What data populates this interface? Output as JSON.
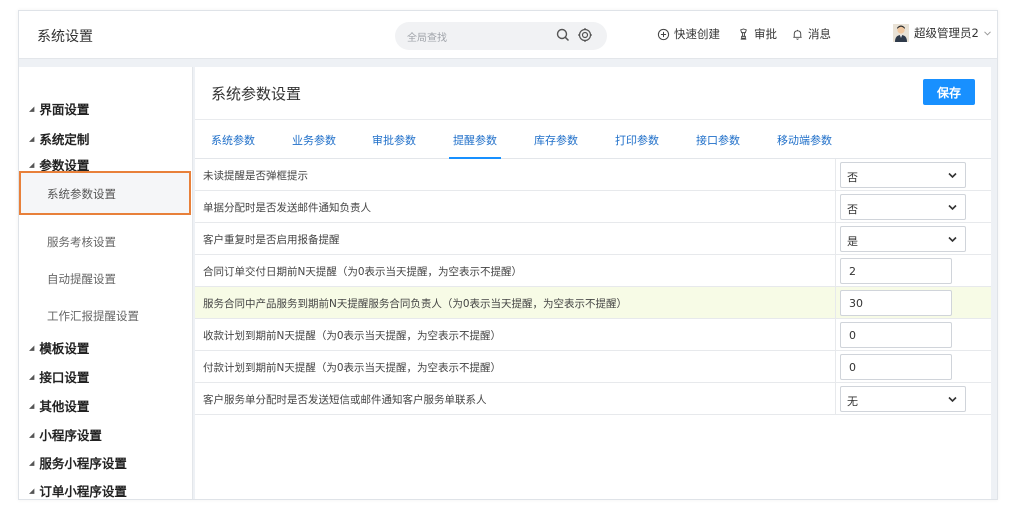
{
  "header": {
    "app_title": "系统设置",
    "search_placeholder": "全局查找",
    "quick_create": "快速创建",
    "approve": "审批",
    "messages": "消息",
    "user_name": "超级管理员2"
  },
  "sidebar": {
    "groups": {
      "ui": "界面设置",
      "custom": "系统定制",
      "params": "参数设置",
      "template": "模板设置",
      "api": "接口设置",
      "other": "其他设置",
      "miniapp": "小程序设置",
      "service_miniapp": "服务小程序设置",
      "order_miniapp": "订单小程序设置"
    },
    "params_items": {
      "system": "系统参数设置",
      "service_eval": "服务考核设置",
      "auto_remind": "自动提醒设置",
      "work_report": "工作汇报提醒设置"
    }
  },
  "main": {
    "title": "系统参数设置",
    "save_label": "保存",
    "tabs": [
      "系统参数",
      "业务参数",
      "审批参数",
      "提醒参数",
      "库存参数",
      "打印参数",
      "接口参数",
      "移动端参数"
    ],
    "active_tab": "提醒参数",
    "rows": [
      {
        "label": "未读提醒是否弹框提示",
        "type": "select",
        "value": "否"
      },
      {
        "label": "单据分配时是否发送邮件通知负责人",
        "type": "select",
        "value": "否"
      },
      {
        "label": "客户重复时是否启用报备提醒",
        "type": "select",
        "value": "是"
      },
      {
        "label": "合同订单交付日期前N天提醒（为0表示当天提醒，为空表示不提醒）",
        "type": "input",
        "value": "2"
      },
      {
        "label": "服务合同中产品服务到期前N天提醒服务合同负责人（为0表示当天提醒，为空表示不提醒）",
        "type": "input",
        "value": "30"
      },
      {
        "label": "收款计划到期前N天提醒（为0表示当天提醒，为空表示不提醒）",
        "type": "input",
        "value": "0"
      },
      {
        "label": "付款计划到期前N天提醒（为0表示当天提醒，为空表示不提醒）",
        "type": "input",
        "value": "0"
      },
      {
        "label": "客户服务单分配时是否发送短信或邮件通知客户服务单联系人",
        "type": "select",
        "value": "无"
      }
    ]
  },
  "colors": {
    "accent": "#1890ff",
    "highlight_border": "#e8803a",
    "highlight_row": "#f7fbe6"
  }
}
